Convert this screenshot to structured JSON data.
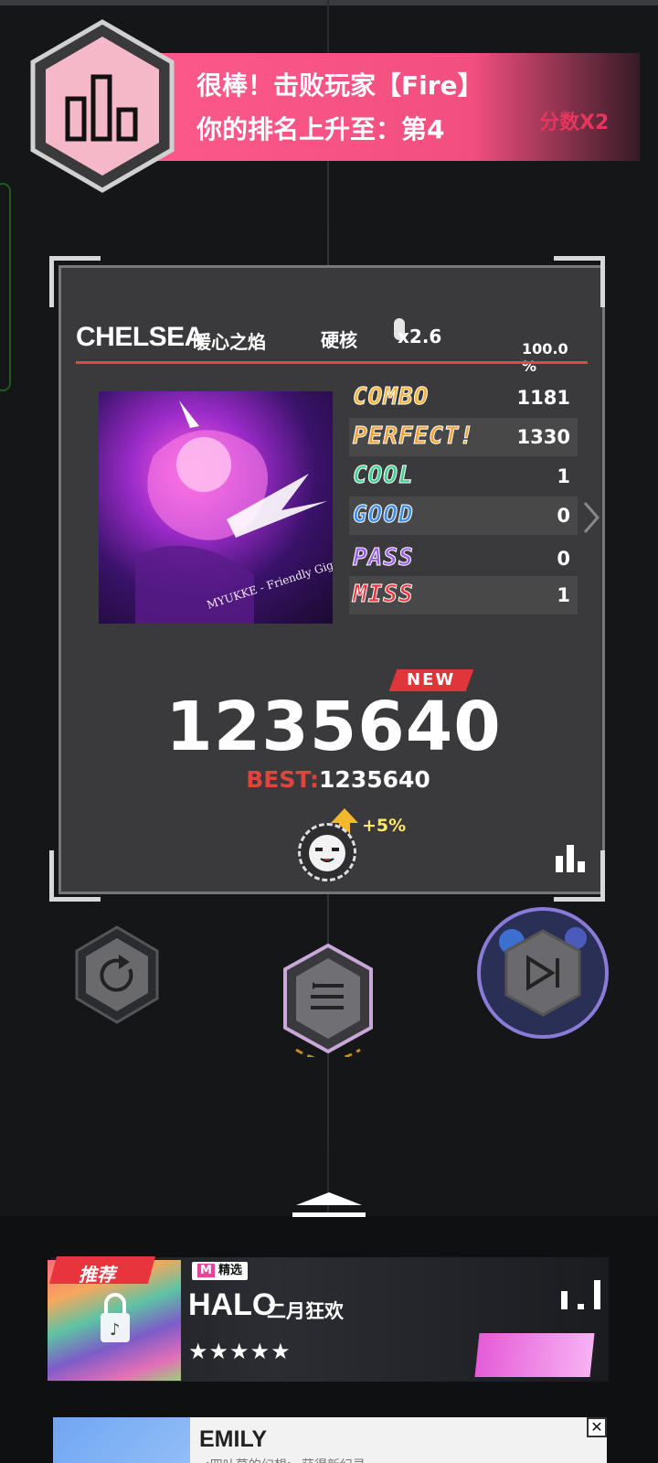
{
  "banner": {
    "line1": "很棒！击败玩家【Fire】",
    "line2": "你的排名上升至：第4",
    "ghost_text": "分数X2"
  },
  "result": {
    "song_title": "CHELSEA",
    "song_subtitle": "暖心之焰",
    "difficulty": "硬核",
    "speed": "x2.6",
    "accuracy": "100.0 %",
    "cover_artist_text": "MYUKKE - Friendly Gigant Fire",
    "stats": [
      {
        "label": "COMBO",
        "value": "1181",
        "color": "#f5b33a"
      },
      {
        "label": "PERFECT!",
        "value": "1330",
        "color": "#f5a032"
      },
      {
        "label": "COOL",
        "value": "1",
        "color": "#3fd08f"
      },
      {
        "label": "GOOD",
        "value": "0",
        "color": "#3c8cf0"
      },
      {
        "label": "PASS",
        "value": "0",
        "color": "#9b5cf0"
      },
      {
        "label": "MISS",
        "value": "1",
        "color": "#e8353e"
      }
    ],
    "new_label": "NEW",
    "score": "1235640",
    "best_label": "BEST:",
    "best_value": "1235640",
    "bonus": "+5%"
  },
  "buttons": {
    "retry": "retry-icon",
    "menu": "menu-list-icon",
    "next": "skip-next-icon"
  },
  "recommend": {
    "tag": "推荐",
    "badge_m": "M",
    "badge_text": "精选",
    "title": "HALO",
    "subtitle": "二月狂欢",
    "stars": "★★★★★"
  },
  "emily": {
    "title": "EMILY",
    "subtitle": "<四叶草的幻想> 获得新纪录"
  },
  "colors": {
    "banner_pink": "#f24f80",
    "accent_red": "#e0453d",
    "card_bg": "#3a3a3c"
  }
}
